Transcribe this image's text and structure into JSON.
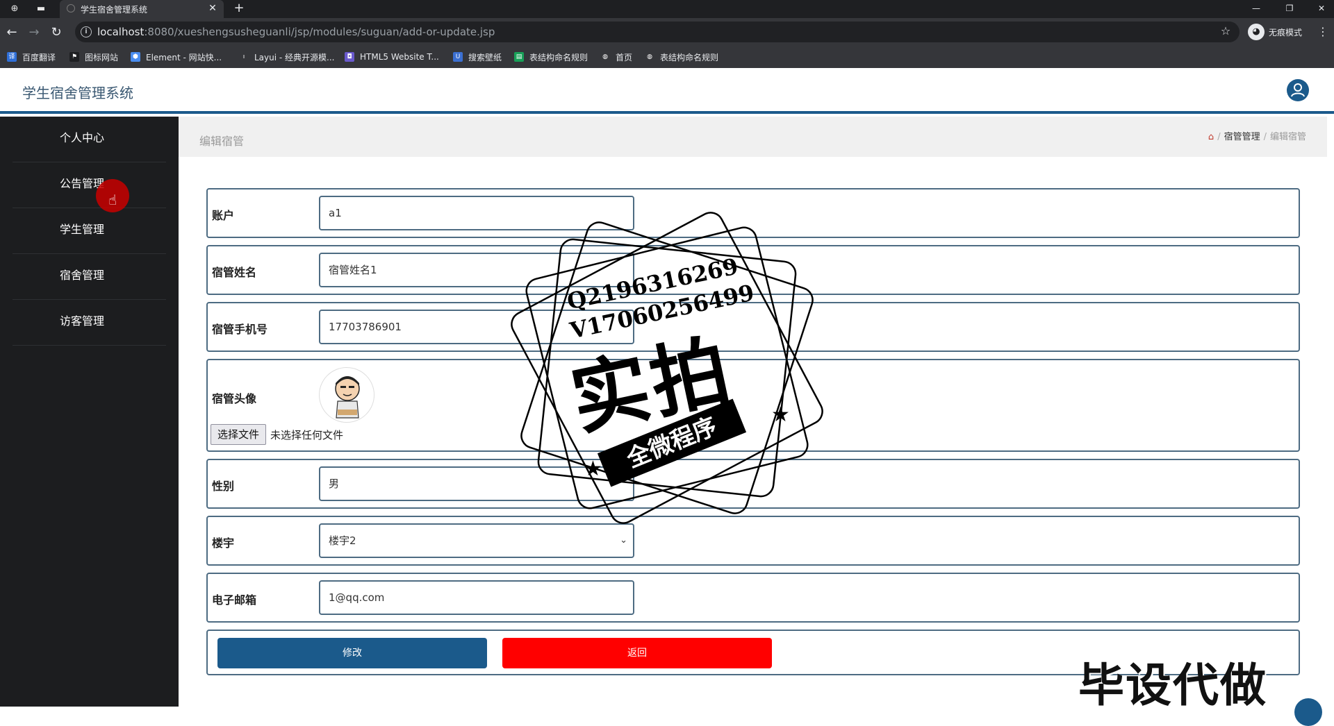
{
  "browser": {
    "tab_title": "学生宿舍管理系统",
    "url_host": "localhost",
    "url_rest": ":8080/xueshengsusheguanli/jsp/modules/suguan/add-or-update.jsp",
    "incognito_label": "无痕模式",
    "bookmarks": [
      {
        "label": "百度翻译",
        "icon_color": "#2f6fd8"
      },
      {
        "label": "图标网站",
        "icon_color": "#1e1f22"
      },
      {
        "label": "Element - 网站快...",
        "icon_color": "#4a8df0"
      },
      {
        "label": "Layui - 经典开源模...",
        "icon_color": "#35363a"
      },
      {
        "label": "HTML5 Website T...",
        "icon_color": "#6a5acd"
      },
      {
        "label": "搜索壁纸",
        "icon_color": "#3b6fd1"
      },
      {
        "label": "表结构命名规则",
        "icon_color": "#18a058"
      },
      {
        "label": "首页",
        "icon_color": "#35363a"
      },
      {
        "label": "表结构命名规则",
        "icon_color": "#35363a"
      }
    ]
  },
  "app": {
    "title": "学生宿舍管理系统",
    "accent_color": "#1b5a8b"
  },
  "sidebar": {
    "items": [
      {
        "label": "个人中心"
      },
      {
        "label": "公告管理"
      },
      {
        "label": "学生管理"
      },
      {
        "label": "宿舍管理"
      },
      {
        "label": "访客管理"
      }
    ]
  },
  "page": {
    "title": "编辑宿管",
    "breadcrumb": {
      "parent": "宿管管理",
      "current": "编辑宿管"
    }
  },
  "form": {
    "account": {
      "label": "账户",
      "value": "a1"
    },
    "name": {
      "label": "宿管姓名",
      "value": "宿管姓名1"
    },
    "phone": {
      "label": "宿管手机号",
      "value": "17703786901"
    },
    "avatar": {
      "label": "宿管头像",
      "choose_label": "选择文件",
      "status": "未选择任何文件"
    },
    "gender": {
      "label": "性别",
      "value": "男"
    },
    "building": {
      "label": "楼宇",
      "value": "楼宇2"
    },
    "email": {
      "label": "电子邮箱",
      "value": "1@qq.com"
    },
    "submit_label": "修改",
    "back_label": "返回"
  },
  "watermark": {
    "qq": "Q2196316269",
    "vx": "V17060256499",
    "main": "实拍",
    "ribbon": "全微程序",
    "bottom": "毕设代做"
  }
}
